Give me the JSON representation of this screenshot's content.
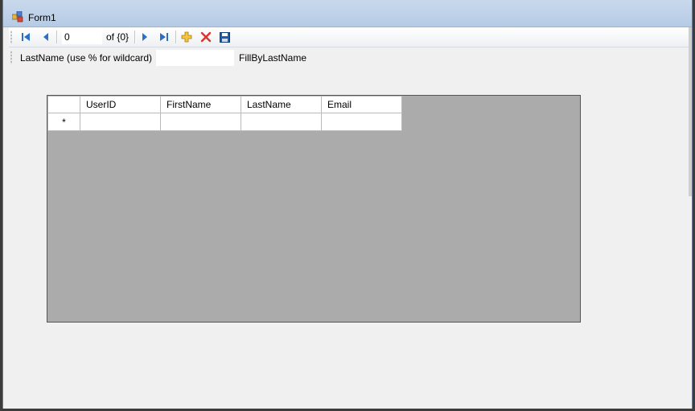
{
  "window": {
    "title": "Form1"
  },
  "navigator": {
    "position": "0",
    "count_label": "of {0}",
    "icons": [
      "move-first-icon",
      "move-previous-icon",
      "move-next-icon",
      "move-last-icon",
      "add-new-icon",
      "delete-icon",
      "save-icon"
    ]
  },
  "fill_toolbar": {
    "label": "LastName (use % for wildcard)",
    "input_value": "",
    "button_label": "FillByLastName"
  },
  "grid": {
    "columns": [
      "UserID",
      "FirstName",
      "LastName",
      "Email"
    ],
    "new_row_marker": "*",
    "background_color": "#ababab"
  }
}
